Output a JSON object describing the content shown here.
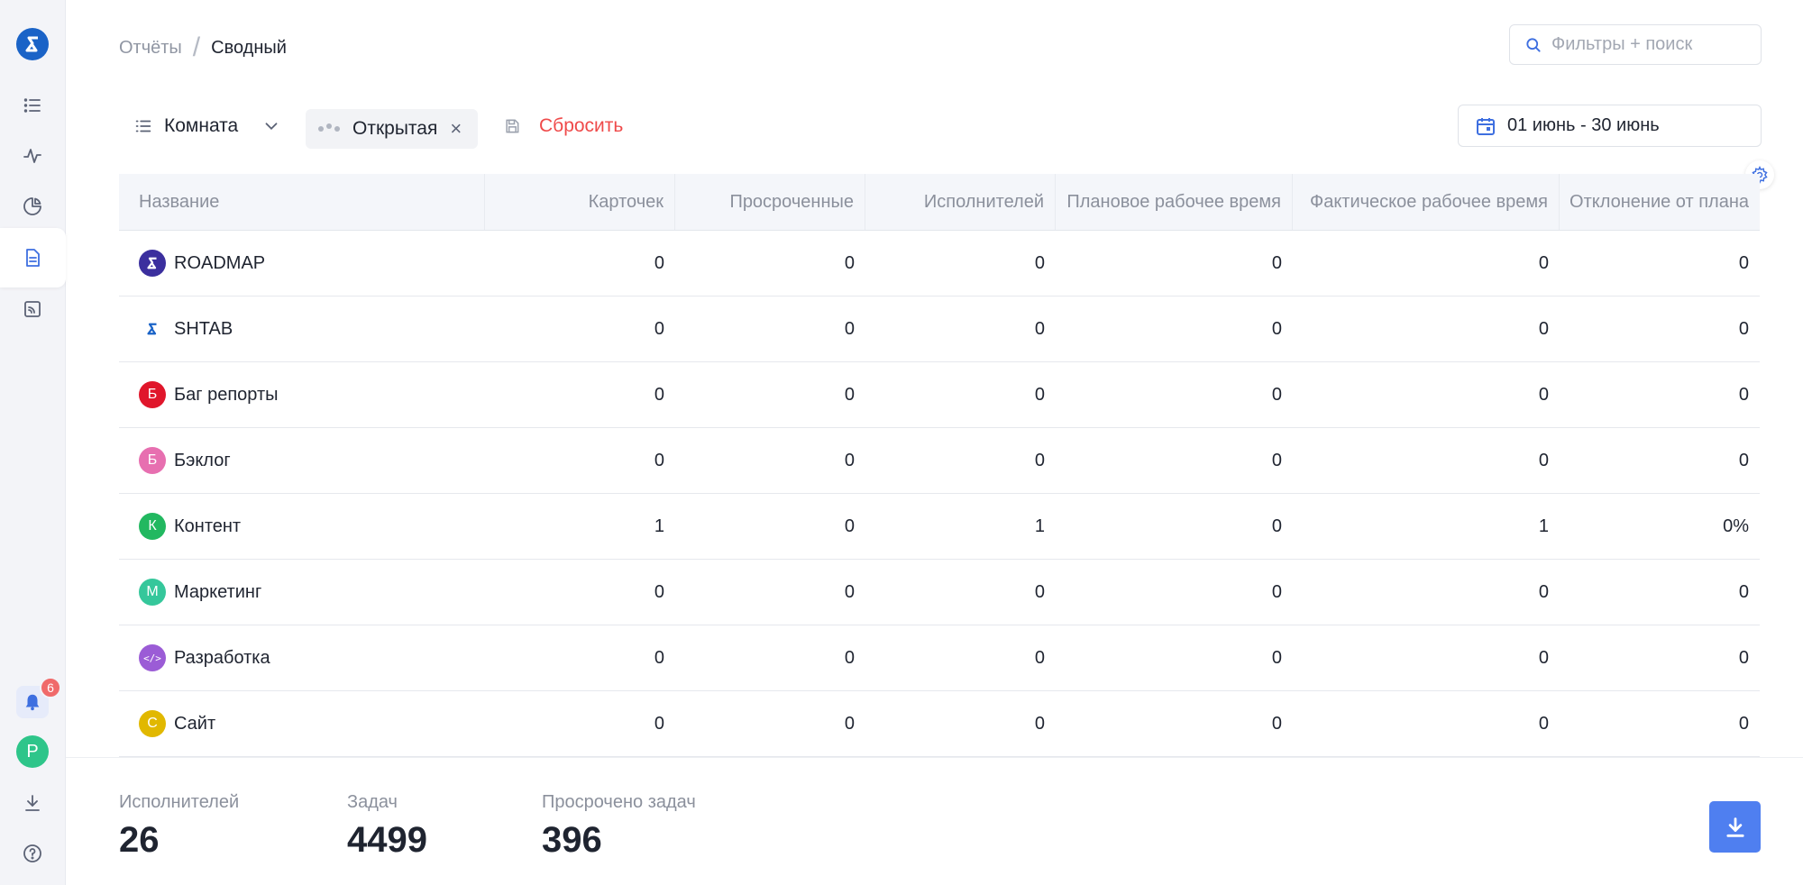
{
  "breadcrumb": {
    "parent": "Отчёты",
    "separator": "/",
    "current": "Сводный"
  },
  "search": {
    "placeholder": "Фильтры + поиск",
    "value": ""
  },
  "filters": {
    "group_label": "Комната",
    "chip_label": "Открытая",
    "chip_close": "×",
    "reset_label": "Сбросить"
  },
  "date_range": {
    "label": "01 июнь - 30 июнь"
  },
  "notifications": {
    "count": "6"
  },
  "user": {
    "initial": "P"
  },
  "table": {
    "headers": [
      "Название",
      "Карточек",
      "Просроченные",
      "Исполнителей",
      "Плановое рабочее время",
      "Фактическое рабочее время",
      "Отклонение от плана"
    ],
    "rows": [
      {
        "name": "ROADMAP",
        "icon": "roadmap-logo",
        "initial": "",
        "color": "#3b2f9e",
        "values": [
          "0",
          "0",
          "0",
          "0",
          "0",
          "0"
        ]
      },
      {
        "name": "SHTAB",
        "icon": "shtab-logo",
        "initial": "",
        "color": "#1a63c7",
        "values": [
          "0",
          "0",
          "0",
          "0",
          "0",
          "0"
        ]
      },
      {
        "name": "Баг репорты",
        "icon": "letter-avatar",
        "initial": "Б",
        "color": "#e0162b",
        "values": [
          "0",
          "0",
          "0",
          "0",
          "0",
          "0"
        ]
      },
      {
        "name": "Бэклог",
        "icon": "letter-avatar",
        "initial": "Б",
        "color": "#e76fb0",
        "values": [
          "0",
          "0",
          "0",
          "0",
          "0",
          "0"
        ]
      },
      {
        "name": "Контент",
        "icon": "letter-avatar",
        "initial": "К",
        "color": "#22b860",
        "values": [
          "1",
          "0",
          "1",
          "0",
          "1",
          "0%"
        ]
      },
      {
        "name": "Маркетинг",
        "icon": "letter-avatar",
        "initial": "М",
        "color": "#35c79b",
        "values": [
          "0",
          "0",
          "0",
          "0",
          "0",
          "0"
        ]
      },
      {
        "name": "Разработка",
        "icon": "code-icon",
        "initial": "</>",
        "color": "#9b5cd6",
        "values": [
          "0",
          "0",
          "0",
          "0",
          "0",
          "0"
        ]
      },
      {
        "name": "Сайт",
        "icon": "letter-avatar",
        "initial": "С",
        "color": "#e1b800",
        "values": [
          "0",
          "0",
          "0",
          "0",
          "0",
          "0"
        ]
      }
    ]
  },
  "footer": {
    "executors_label": "Исполнителей",
    "executors_value": "26",
    "tasks_label": "Задач",
    "tasks_value": "4499",
    "overdue_label": "Просрочено задач",
    "overdue_value": "396"
  },
  "colors": {
    "accent": "#4f7ff0",
    "danger": "#ef4a4a",
    "sidebar_bg": "#f3f4f8"
  }
}
